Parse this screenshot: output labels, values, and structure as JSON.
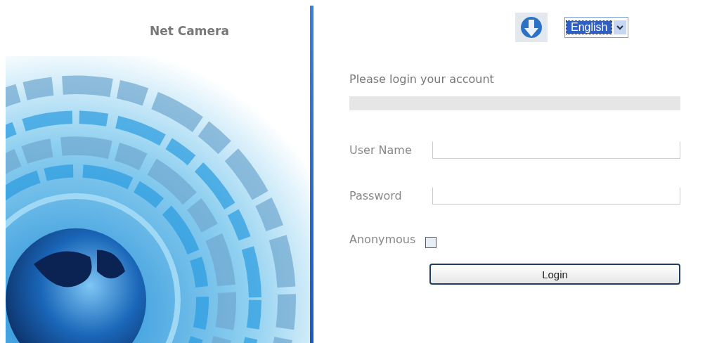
{
  "brand": {
    "title": "Net Camera"
  },
  "language_select": {
    "value": "English"
  },
  "login": {
    "prompt": "Please login your account",
    "fields": [
      {
        "label": "User Name"
      },
      {
        "label": "Password"
      }
    ],
    "anonymous": {
      "label": "Anonymous",
      "checked": false
    },
    "submit": "Login"
  }
}
